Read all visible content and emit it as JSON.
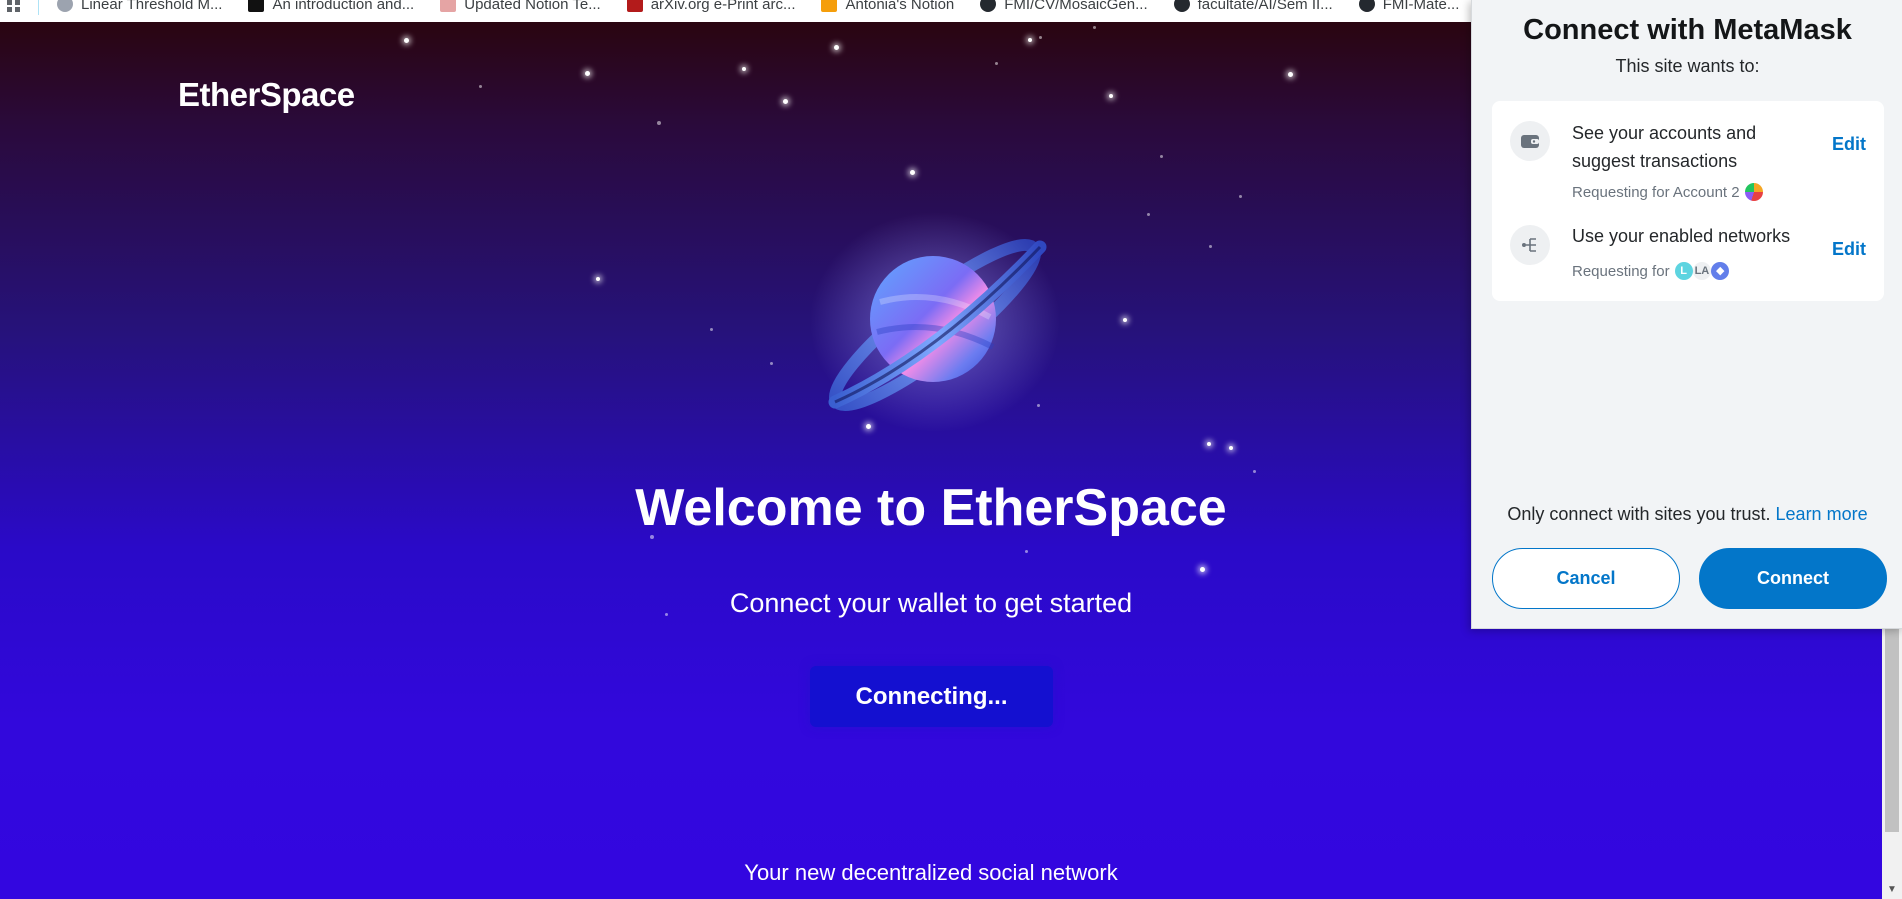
{
  "bookmarks": [
    {
      "label": "Linear Threshold M...",
      "icon": "bookmark-favicon",
      "color": "#6b7280"
    },
    {
      "label": "An introduction and...",
      "icon": "medium-icon",
      "color": "#111111"
    },
    {
      "label": "Updated Notion Te...",
      "icon": "notion-template-icon",
      "color": "#e5a4a4"
    },
    {
      "label": "arXiv.org e-Print arc...",
      "icon": "arxiv-icon",
      "color": "#b31b1b"
    },
    {
      "label": "Antonia's Notion",
      "icon": "notion-page-icon",
      "color": "#f59e0b"
    },
    {
      "label": "FMI/CV/MosaicGen...",
      "icon": "github-icon",
      "color": "#24292f"
    },
    {
      "label": "facultate/AI/Sem II...",
      "icon": "github-icon",
      "color": "#24292f"
    },
    {
      "label": "FMI-Mate...",
      "icon": "github-icon",
      "color": "#24292f"
    }
  ],
  "page": {
    "brand": "EtherSpace",
    "welcome": "Welcome to EtherSpace",
    "subtitle": "Connect your wallet to get started",
    "connect_button": "Connecting...",
    "footer": "Your new decentralized social network"
  },
  "metamask": {
    "title": "Connect with MetaMask",
    "subtitle": "This site wants to:",
    "permissions": [
      {
        "title": "See your accounts and suggest transactions",
        "requesting": "Requesting for Account 2",
        "edit": "Edit",
        "icon": "wallet-icon"
      },
      {
        "title": "Use your enabled networks",
        "requesting": "Requesting for",
        "network_badges": [
          "L",
          "LA"
        ],
        "edit": "Edit",
        "icon": "network-tree-icon"
      }
    ],
    "trust_text": "Only connect with sites you trust.",
    "learn_more": "Learn more",
    "cancel": "Cancel",
    "connect": "Connect"
  },
  "colors": {
    "metamask_blue": "#0376c9",
    "button_blue": "#1410d0"
  }
}
